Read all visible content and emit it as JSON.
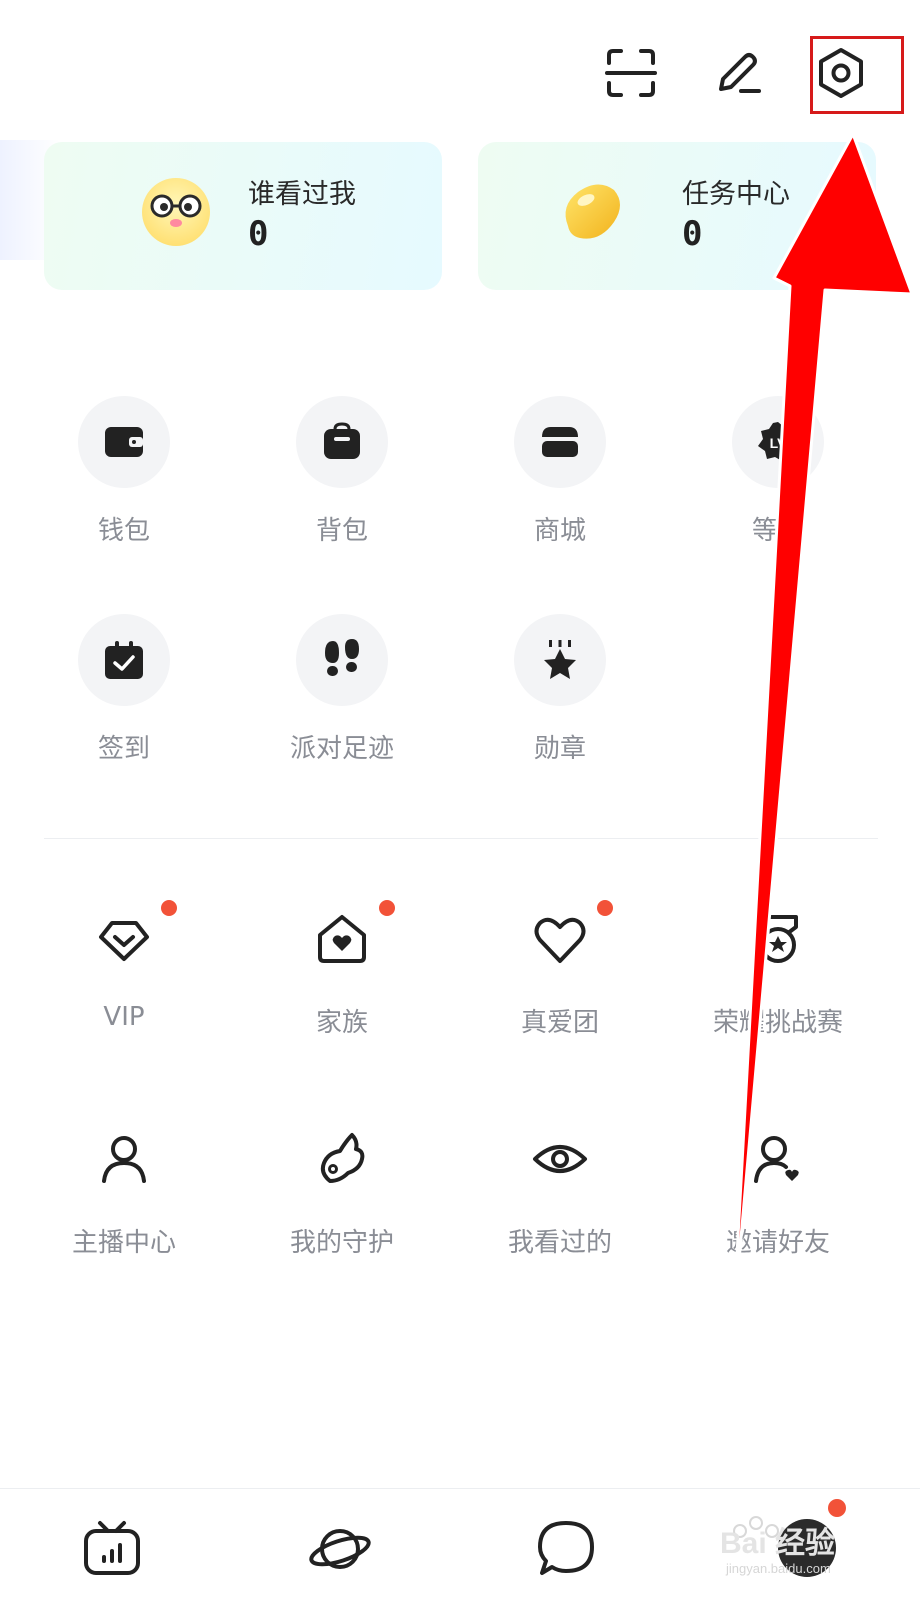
{
  "stats": {
    "left": {
      "title": "谁看过我",
      "value": "0"
    },
    "right": {
      "title": "任务中心",
      "value": "0"
    }
  },
  "grid_row1": [
    {
      "label": "钱包",
      "icon": "wallet-icon"
    },
    {
      "label": "背包",
      "icon": "backpack-icon"
    },
    {
      "label": "商城",
      "icon": "store-icon"
    },
    {
      "label": "等级",
      "icon": "level-lv-icon"
    }
  ],
  "grid_row2": [
    {
      "label": "签到",
      "icon": "calendar-check-icon"
    },
    {
      "label": "派对足迹",
      "icon": "footprints-icon"
    },
    {
      "label": "勋章",
      "icon": "medal-star-icon"
    }
  ],
  "features_row1": [
    {
      "label": "VIP",
      "icon": "diamond-icon",
      "badge": true
    },
    {
      "label": "家族",
      "icon": "house-heart-icon",
      "badge": true
    },
    {
      "label": "真爱团",
      "icon": "heart-icon",
      "badge": true
    },
    {
      "label": "荣耀挑战赛",
      "icon": "trophy-badge-icon",
      "badge": false
    }
  ],
  "features_row2": [
    {
      "label": "主播中心",
      "icon": "user-icon"
    },
    {
      "label": "我的守护",
      "icon": "wing-icon"
    },
    {
      "label": "我看过的",
      "icon": "eye-icon"
    },
    {
      "label": "邀请好友",
      "icon": "user-add-icon"
    }
  ],
  "bottom_nav": [
    {
      "icon": "tv-icon"
    },
    {
      "icon": "planet-icon"
    },
    {
      "icon": "chat-bubble-icon"
    },
    {
      "icon": "avatar-profile",
      "badge": true
    }
  ],
  "watermark": {
    "text": "Bai 经验",
    "sub": "jingyan.baidu.com"
  },
  "colors": {
    "highlight": "#d61a1a",
    "arrow": "#ff0000",
    "badge": "#f25238",
    "label": "#8a8d95",
    "icon": "#222222"
  }
}
